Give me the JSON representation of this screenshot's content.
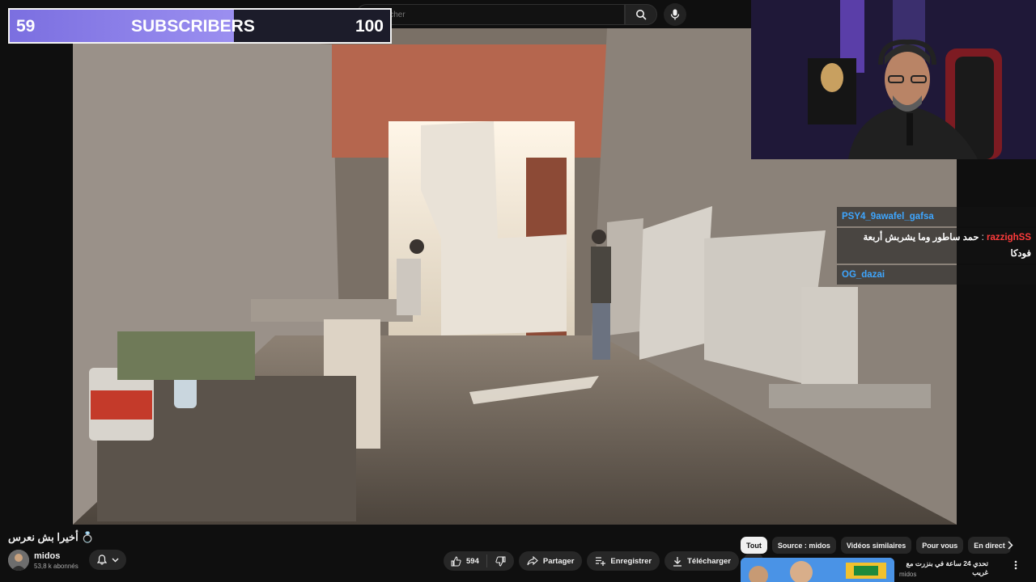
{
  "search": {
    "placeholder": "Rechercher"
  },
  "subscriber_goal": {
    "current": "59",
    "label": "SUBSCRIBERS",
    "goal": "100",
    "progress_fraction": 0.59
  },
  "chat": {
    "messages": [
      {
        "user": "PSY4_9awafel_gafsa",
        "text": ""
      },
      {
        "user": "razzighSS",
        "text": "حمد ساطور وما يشربش أربعة فودكا"
      },
      {
        "user": "OG_dazai",
        "text": ""
      }
    ]
  },
  "video": {
    "title": "أخيرا بش نعرس 💍",
    "channel_name": "midos",
    "channel_subs": "53,8 k abonnés"
  },
  "actions": {
    "likes": "594",
    "share": "Partager",
    "save": "Enregistrer",
    "download": "Télécharger"
  },
  "chips": [
    "Tout",
    "Source : midos",
    "Vidéos similaires",
    "Pour vous",
    "En direct"
  ],
  "recommendation": {
    "title": "تحدي 24 ساعة في بنزرت مع غريب",
    "channel": "midos"
  },
  "colors": {
    "accent_blue": "#3ea6ff",
    "progress_purple": "#8a7fe8",
    "background": "#0f0f0f"
  }
}
